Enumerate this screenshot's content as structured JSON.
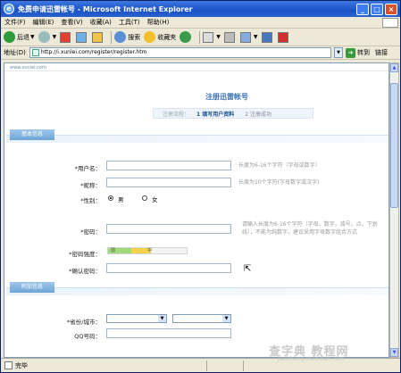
{
  "window": {
    "title": "免费申请迅雷帐号 - Microsoft Internet Explorer"
  },
  "menu": [
    "文件(F)",
    "编辑(E)",
    "查看(V)",
    "收藏(A)",
    "工具(T)",
    "帮助(H)"
  ],
  "toolbar": {
    "back": "后退",
    "search": "搜索",
    "favorites": "收藏夹"
  },
  "address": {
    "label": "地址(D)",
    "url": "http://i.xunlei.com/register/register.htm",
    "go": "转到",
    "links": "链接"
  },
  "page": {
    "logo": "www.xunlei.com",
    "title": "注册迅雷帐号",
    "steps": {
      "label": "注册流程：",
      "step1": "1 填写用户资料",
      "step2": "2 注册成功"
    },
    "section_basic": "基本信息",
    "section_extra": "附加信息",
    "fields": {
      "username": "*用户名：",
      "nickname": "*昵称：",
      "gender": "*性别：",
      "male": "男",
      "female": "女",
      "password": "*密码：",
      "strength": "*密码强度：",
      "confirm": "*确认密码：",
      "province": "*省份/城市：",
      "qq": "QQ号码："
    },
    "hints": {
      "username": "长度为6-16个字符（字母或数字）",
      "nickname": "长度为10个字符(字母数字或汉字)",
      "password": "请输入长度为6-16个字符（字母，数字，减号，点，下划线），不能为纯数字，建议采用字母数字组合方式"
    },
    "strength": {
      "weak": "弱",
      "medium": "中",
      "level": 0.55
    }
  },
  "status": {
    "text": "完毕"
  },
  "watermark": {
    "main": "查字典 教程网",
    "sub": "jiaocheng.chazidian.com"
  }
}
